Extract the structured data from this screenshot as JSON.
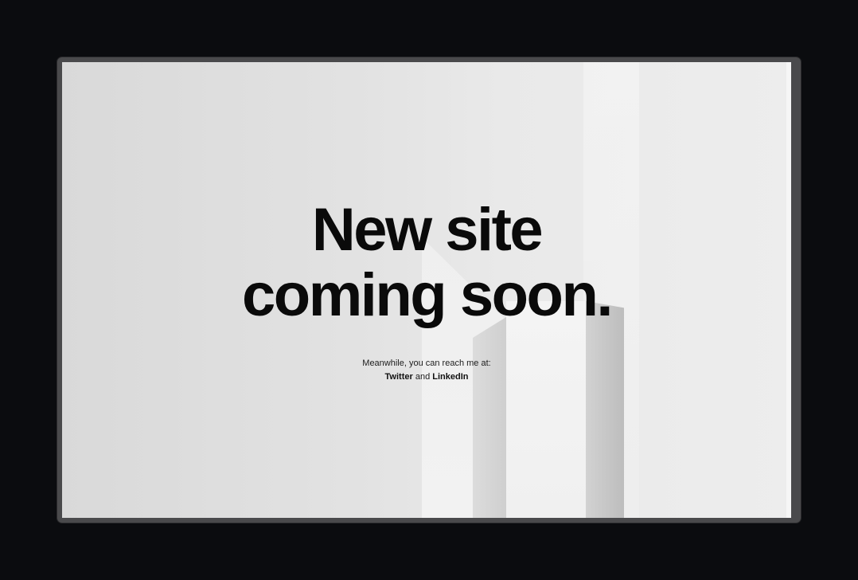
{
  "page": {
    "headline_line1": "New site",
    "headline_line2": "coming soon.",
    "subtext": "Meanwhile, you can reach me at:",
    "links": {
      "twitter_label": "Twitter",
      "separator": "and",
      "linkedin_label": "LinkedIn"
    }
  },
  "colors": {
    "background": "#0b0c0f",
    "frame": "#4a4a4c",
    "text": "#0a0a0a"
  }
}
